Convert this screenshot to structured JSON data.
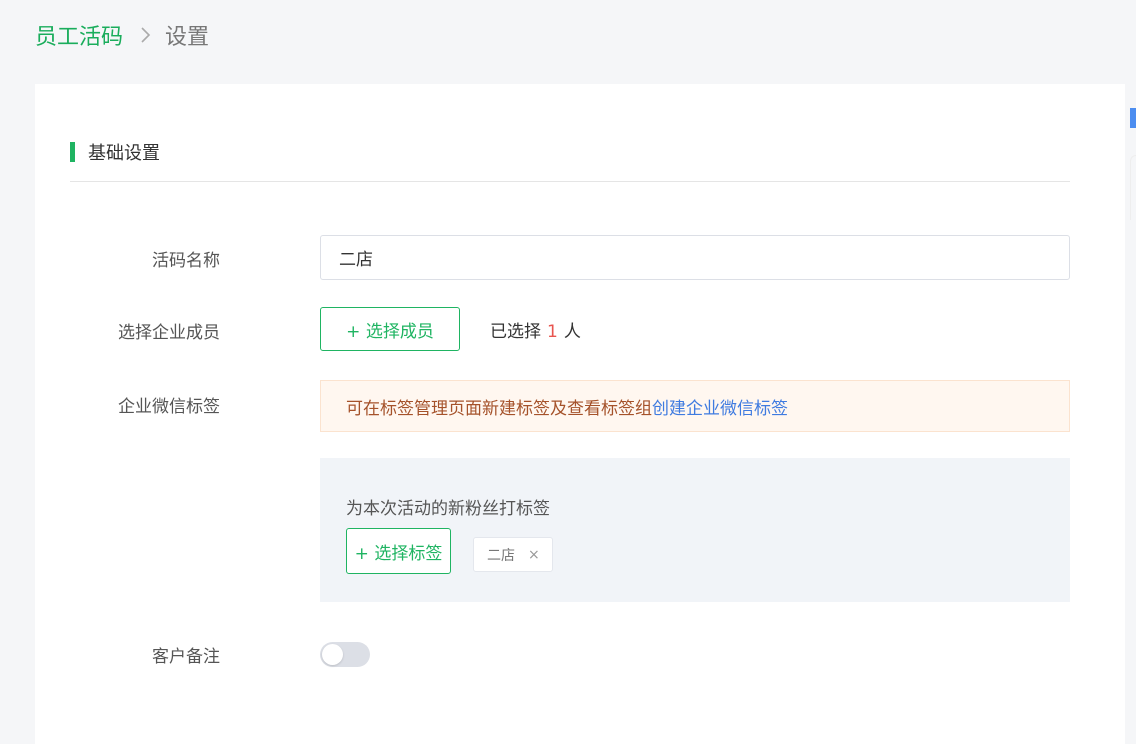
{
  "breadcrumb": {
    "home": "员工活码",
    "current": "设置"
  },
  "section": {
    "title": "基础设置"
  },
  "form": {
    "name_label": "活码名称",
    "name_value": "二店",
    "member_label": "选择企业成员",
    "select_member_button": "+ 选择成员",
    "selected_prefix": "已选择",
    "selected_count": "1",
    "selected_suffix": "人",
    "tag_label": "企业微信标签",
    "notice_text": "可在标签管理页面新建标签及查看标签组",
    "notice_link": "创建企业微信标签",
    "tag_hint": "为本次活动的新粉丝打标签",
    "select_tag_button": "+ 选择标签",
    "tags": [
      "二店"
    ],
    "remark_label": "客户备注",
    "remark_enabled": false
  },
  "colors": {
    "accent_green": "#1fb462",
    "link_blue": "#3f7be0",
    "count_red": "#e8554f"
  }
}
